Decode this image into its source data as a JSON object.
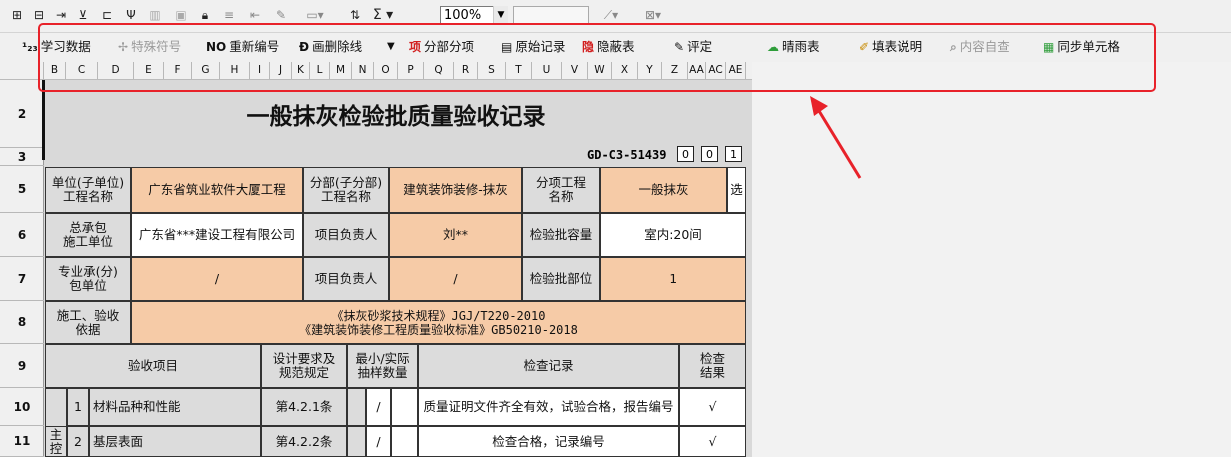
{
  "toolbar1": {
    "zoom": "100%",
    "icons": [
      "insert-row-icon",
      "insert-col-icon",
      "add-row-icon",
      "merge-icon",
      "split-icon",
      "print-icon",
      "save-icon",
      "lock-icon",
      "line-spacing-icon",
      "indent-icon",
      "format-painter-icon",
      "border-icon",
      "sort-icon",
      "sum-icon",
      "line-style-icon",
      "color-icon"
    ]
  },
  "toolbar2": {
    "items": [
      {
        "icon": "¹₂₃",
        "label": "学习数据",
        "disabled": false
      },
      {
        "icon": "✢",
        "label": "特殊符号",
        "disabled": true
      },
      {
        "icon": "NO",
        "label": "重新编号",
        "disabled": false
      },
      {
        "icon": "Đ",
        "label": "画删除线",
        "disabled": false
      },
      {
        "icon": "▼",
        "label": "",
        "disabled": false
      },
      {
        "icon": "项",
        "label": "分部分项",
        "disabled": false
      },
      {
        "icon": "▤",
        "label": "原始记录",
        "disabled": false
      },
      {
        "icon": "隐",
        "label": "隐蔽表",
        "disabled": false
      },
      {
        "icon": "✎",
        "label": "评定",
        "disabled": false
      },
      {
        "icon": "☁",
        "label": "晴雨表",
        "disabled": false
      },
      {
        "icon": "✐",
        "label": "填表说明",
        "disabled": false
      },
      {
        "icon": "⌕",
        "label": "内容自查",
        "disabled": true
      },
      {
        "icon": "▦",
        "label": "同步单元格",
        "disabled": false
      }
    ]
  },
  "colors": {
    "highlight": "#e8222a",
    "label_bg": "#dcdcdc",
    "input_bg": "#f6cba7"
  },
  "columns": [
    "B",
    "C",
    "D",
    "E",
    "F",
    "G",
    "H",
    "I",
    "J",
    "K",
    "L",
    "M",
    "N",
    "O",
    "P",
    "Q",
    "R",
    "S",
    "T",
    "U",
    "V",
    "W",
    "X",
    "Y",
    "Z",
    "AA",
    "AC",
    "AE"
  ],
  "rows": [
    "2",
    "3",
    "5",
    "6",
    "7",
    "8",
    "9",
    "10",
    "11"
  ],
  "form": {
    "title": "一般抹灰检验批质量验收记录",
    "code": "GD-C3-51439",
    "code_boxes": [
      "0",
      "0",
      "1"
    ],
    "r5": {
      "unit_label": "单位(子单位)\n工程名称",
      "unit_value": "广东省筑业软件大厦工程",
      "part_label": "分部(子分部)\n工程名称",
      "part_value": "建筑装饰装修-抹灰",
      "item_label": "分项工程\n名称",
      "item_value": "一般抹灰",
      "select_label": "选"
    },
    "r6": {
      "contractor_label": "总承包\n施工单位",
      "contractor_value": "广东省***建设工程有限公司",
      "pm_label": "项目负责人",
      "pm_value": "刘**",
      "capacity_label": "检验批容量",
      "capacity_value": "室内:20间"
    },
    "r7": {
      "sub_label": "专业承(分)\n包单位",
      "sub_value": "/",
      "pm_label": "项目负责人",
      "pm_value": "/",
      "part_label": "检验批部位",
      "part_value": "1"
    },
    "r8": {
      "basis_label": "施工、验收\n依据",
      "basis_value": "《抹灰砂浆技术规程》JGJ/T220-2010\n《建筑装饰装修工程质量验收标准》GB50210-2018"
    },
    "r9": {
      "h1": "验收项目",
      "h2": "设计要求及\n规范规定",
      "h3": "最小/实际\n抽样数量",
      "h4": "检查记录",
      "h5": "检查\n结果"
    },
    "r10": {
      "no": "1",
      "item": "材料品种和性能",
      "spec": "第4.2.1条",
      "sample": "/",
      "record": "质量证明文件齐全有效，试验合格，报告编号",
      "result": "√"
    },
    "r11": {
      "group": "主控",
      "no": "2",
      "item": "基层表面",
      "spec": "第4.2.2条",
      "sample": "/",
      "record": "检查合格，记录编号",
      "result": "√"
    }
  }
}
